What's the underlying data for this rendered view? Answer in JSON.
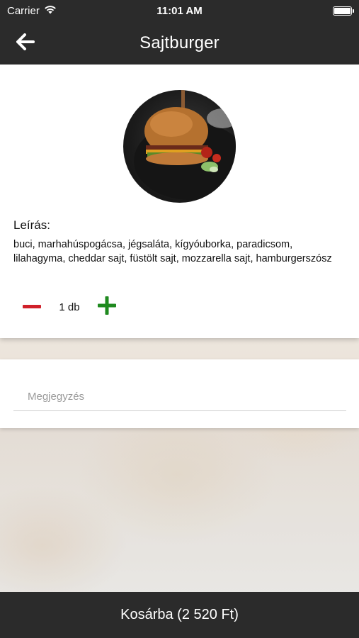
{
  "status_bar": {
    "carrier": "Carrier",
    "time": "11:01 AM",
    "icons": [
      "wifi-icon",
      "battery-icon"
    ]
  },
  "nav": {
    "title": "Sajtburger",
    "back_icon": "arrow-left-icon"
  },
  "product": {
    "image": "burger-photo",
    "description_heading": "Leírás:",
    "description": "buci, marhahúspogácsa, jégsaláta, kígyóuborka, paradicsom, lilahagyma, cheddar sajt, füstölt sajt, mozzarella sajt, hamburgerszósz",
    "quantity": "1 db",
    "minus_icon": "minus-icon",
    "plus_icon": "plus-icon",
    "colors": {
      "minus": "#d0202a",
      "plus": "#1f8a1f"
    }
  },
  "note": {
    "placeholder": "Megjegyzés",
    "value": ""
  },
  "cart": {
    "label": "Kosárba (2 520 Ft)"
  },
  "theme": {
    "bar_color": "#2b2b2b"
  }
}
